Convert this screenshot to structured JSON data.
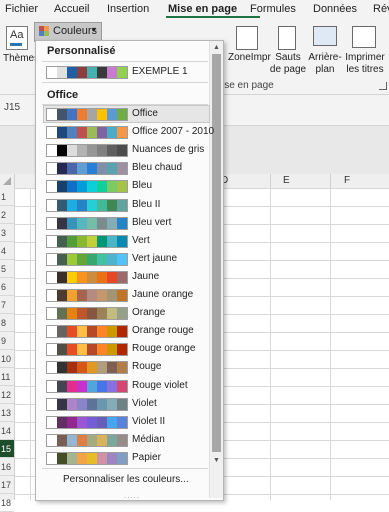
{
  "ribbon": {
    "tabs": [
      {
        "label": "Fichier"
      },
      {
        "label": "Accueil"
      },
      {
        "label": "Insertion"
      },
      {
        "label": "Mise en page",
        "active": true
      },
      {
        "label": "Formules"
      },
      {
        "label": "Données"
      },
      {
        "label": "Rév"
      }
    ],
    "themes_label": "Thèmes",
    "colors_label": "Couleurs",
    "zone_label": "ZoneImpr",
    "breaks_label": "Sauts de page",
    "background_label": "Arrière-plan",
    "print_titles_label": "Imprimer les titres",
    "group_label": "ise en page",
    "accent_color": "#217346"
  },
  "namebox": "J15",
  "sheet": {
    "columns": [
      "D",
      "E",
      "F"
    ],
    "rows": [
      "1",
      "2",
      "3",
      "4",
      "5",
      "6",
      "7",
      "8",
      "9",
      "10",
      "11",
      "12",
      "13",
      "14",
      "15",
      "16",
      "17",
      "18"
    ],
    "selected_row": "15"
  },
  "dropdown": {
    "custom_section_title": "Personnalisé",
    "office_section_title": "Office",
    "custom_items": [
      {
        "name": "EXEMPLE 1",
        "colors": [
          "#ffffff",
          "#e0e0e0",
          "#1f5fa5",
          "#8c3f3f",
          "#46b0b0",
          "#3a3a3a",
          "#c97bd1",
          "#92d050"
        ]
      }
    ],
    "office_items": [
      {
        "name": "Office",
        "colors": [
          "#ffffff",
          "#44546a",
          "#4472c4",
          "#ed7d31",
          "#a5a5a5",
          "#ffc000",
          "#5b9bd5",
          "#70ad47"
        ],
        "highlighted": true
      },
      {
        "name": "Office 2007 - 2010",
        "colors": [
          "#ffffff",
          "#1f497d",
          "#4f81bd",
          "#c0504d",
          "#9bbb59",
          "#8064a2",
          "#4bacc6",
          "#f79646"
        ]
      },
      {
        "name": "Nuances de gris",
        "colors": [
          "#ffffff",
          "#000000",
          "#dddddd",
          "#b2b2b2",
          "#969696",
          "#808080",
          "#5f5f5f",
          "#4d4d4d"
        ]
      },
      {
        "name": "Bleu chaud",
        "colors": [
          "#ffffff",
          "#242852",
          "#4a66ac",
          "#629dd1",
          "#297fd5",
          "#7f8fa9",
          "#5aa2ae",
          "#9d90a0"
        ]
      },
      {
        "name": "Bleu",
        "colors": [
          "#ffffff",
          "#17406d",
          "#0f6fc6",
          "#009dd9",
          "#0bd0d9",
          "#10cf9b",
          "#7cca62",
          "#a5c249"
        ]
      },
      {
        "name": "Bleu II",
        "colors": [
          "#ffffff",
          "#335b74",
          "#1cade4",
          "#2683c6",
          "#27ced7",
          "#42ba97",
          "#3e8853",
          "#62a39f"
        ]
      },
      {
        "name": "Bleu vert",
        "colors": [
          "#ffffff",
          "#373545",
          "#3494ba",
          "#58b6c0",
          "#75bda7",
          "#7a8c8e",
          "#84acb6",
          "#2683c6"
        ]
      },
      {
        "name": "Vert",
        "colors": [
          "#ffffff",
          "#455f51",
          "#549e39",
          "#8ab833",
          "#c0cf3a",
          "#029676",
          "#4ab5c4",
          "#0989b1"
        ]
      },
      {
        "name": "Vert jaune",
        "colors": [
          "#ffffff",
          "#455f51",
          "#99cb38",
          "#63a537",
          "#37a76f",
          "#44c1a3",
          "#4eb3cf",
          "#51c3f9"
        ]
      },
      {
        "name": "Jaune",
        "colors": [
          "#ffffff",
          "#39302a",
          "#ffca08",
          "#f8931d",
          "#ce8d3e",
          "#ec7016",
          "#e64823",
          "#9c6a6a"
        ]
      },
      {
        "name": "Jaune orange",
        "colors": [
          "#ffffff",
          "#4e3b30",
          "#f0a22e",
          "#a5644e",
          "#b58b80",
          "#c3986d",
          "#a19574",
          "#c17529"
        ]
      },
      {
        "name": "Orange",
        "colors": [
          "#ffffff",
          "#637052",
          "#e48312",
          "#bd582c",
          "#865640",
          "#9b8357",
          "#c2bc80",
          "#94a088"
        ]
      },
      {
        "name": "Orange rouge",
        "colors": [
          "#ffffff",
          "#696464",
          "#e84c22",
          "#ffbd47",
          "#b64926",
          "#ff8427",
          "#cc9900",
          "#b22600"
        ]
      },
      {
        "name": "Rouge orange",
        "colors": [
          "#ffffff",
          "#505046",
          "#e84c22",
          "#ffbd47",
          "#b64926",
          "#ff8427",
          "#cc9900",
          "#b22600"
        ]
      },
      {
        "name": "Rouge",
        "colors": [
          "#ffffff",
          "#323232",
          "#a5300f",
          "#d55816",
          "#e19825",
          "#b19c7d",
          "#7f5f52",
          "#b27d49"
        ]
      },
      {
        "name": "Rouge violet",
        "colors": [
          "#ffffff",
          "#454551",
          "#e32d91",
          "#c830cc",
          "#4ea6dc",
          "#4775e7",
          "#8971e1",
          "#d54773"
        ]
      },
      {
        "name": "Violet",
        "colors": [
          "#ffffff",
          "#373545",
          "#ad84c6",
          "#8784c7",
          "#5d739a",
          "#6997af",
          "#84acb6",
          "#6f8183"
        ]
      },
      {
        "name": "Violet II",
        "colors": [
          "#ffffff",
          "#632e62",
          "#92278f",
          "#9b57d3",
          "#755dd9",
          "#665eb8",
          "#45a5ed",
          "#5982db"
        ]
      },
      {
        "name": "Médian",
        "colors": [
          "#ffffff",
          "#775f55",
          "#94b6d2",
          "#dd8047",
          "#a5ab81",
          "#d8b25c",
          "#7ba79d",
          "#968c8c"
        ]
      },
      {
        "name": "Papier",
        "colors": [
          "#ffffff",
          "#444d26",
          "#a5b592",
          "#f3a447",
          "#e7bc29",
          "#d092a7",
          "#9c85c0",
          "#809ec2"
        ]
      }
    ],
    "footer_label": "Personnaliser les couleurs...",
    "grip": "....."
  }
}
